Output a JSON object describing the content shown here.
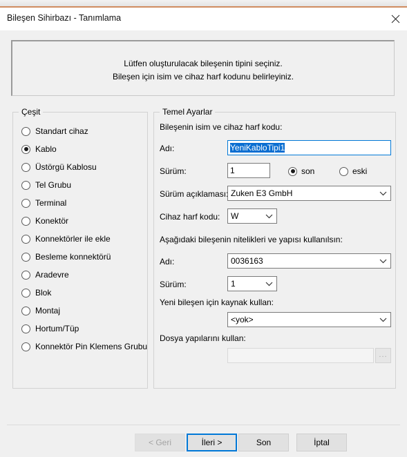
{
  "window": {
    "title": "Bileşen Sihirbazı - Tanımlama",
    "close_icon": "close-icon"
  },
  "banner": {
    "line1": "Lütfen oluşturulacak bileşenin tipini seçiniz.",
    "line2": "Bileşen için isim ve cihaz harf kodunu belirleyiniz."
  },
  "type_group": {
    "legend": "Çeşit",
    "selected": "Kablo",
    "options": [
      {
        "label": "Standart cihaz",
        "checked": false
      },
      {
        "label": "Kablo",
        "checked": true
      },
      {
        "label": "Üstörgü Kablosu",
        "checked": false
      },
      {
        "label": "Tel Grubu",
        "checked": false
      },
      {
        "label": "Terminal",
        "checked": false
      },
      {
        "label": "Konektör",
        "checked": false
      },
      {
        "label": "Konnektörler ile ekle",
        "checked": false
      },
      {
        "label": "Besleme konnektörü",
        "checked": false
      },
      {
        "label": "Aradevre",
        "checked": false
      },
      {
        "label": "Blok",
        "checked": false
      },
      {
        "label": "Montaj",
        "checked": false
      },
      {
        "label": "Hortum/Tüp",
        "checked": false
      },
      {
        "label": "Konnektör Pin Klemens Grubu",
        "checked": false
      }
    ]
  },
  "settings_group": {
    "legend": "Temel Ayarlar",
    "section1_label": "Bileşenin isim ve cihaz harf kodu:",
    "name_label": "Adı:",
    "name_value": "YeniKabloTipi1",
    "version_label": "Sürüm:",
    "version_value": "1",
    "version_mode_new": "son",
    "version_mode_old": "eski",
    "version_mode_selected": "son",
    "version_desc_label": "Sürüm açıklaması:",
    "version_desc_value": "Zuken E3 GmbH",
    "device_code_label": "Cihaz harf kodu:",
    "device_code_value": "W",
    "section2_label": "Aşağıdaki bileşenin nitelikleri ve yapısı kullanılsın:",
    "template_name_label": "Adı:",
    "template_name_value": "0036163",
    "template_version_label": "Sürüm:",
    "template_version_value": "1",
    "source_label": "Yeni bileşen için kaynak kullan:",
    "source_value": "<yok>",
    "filestruct_label": "Dosya yapılarını kullan:",
    "filestruct_value": "",
    "browse_button_label": "...",
    "chevron_icon": "chevron-down-icon"
  },
  "buttons": {
    "back": "< Geri",
    "next": "İleri >",
    "finish": "Son",
    "cancel": "İptal"
  },
  "colors": {
    "accent_line": "#d08c60",
    "focus_blue": "#0078d7",
    "selection_blue": "#0a6ed1",
    "dialog_bg": "#f0f0f0"
  }
}
